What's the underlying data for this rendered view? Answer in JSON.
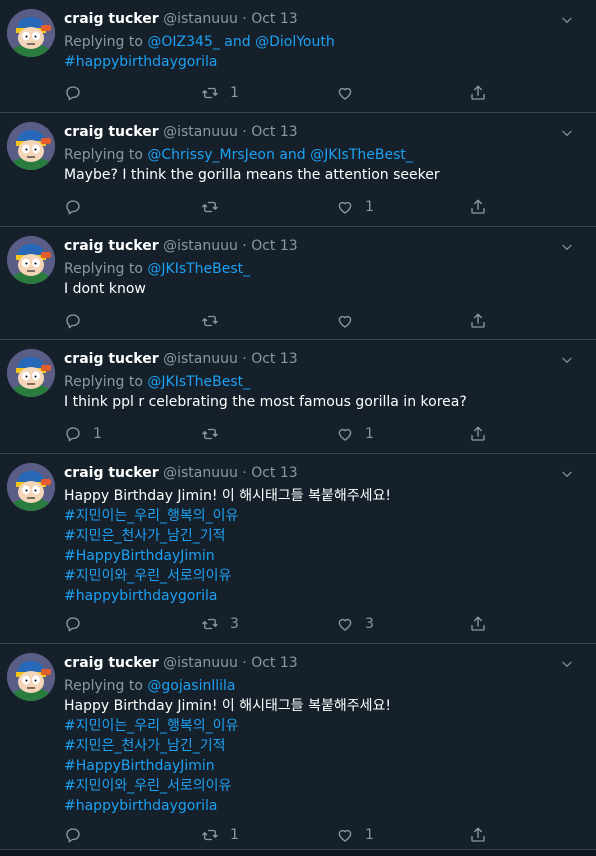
{
  "tweets": [
    {
      "name": "craig tucker",
      "handle": "@istanuuu",
      "sep": "·",
      "time": "Oct 13",
      "reply_prefix": "Replying to",
      "reply_to": "@OIZ345_ and @DiolYouth",
      "text": "",
      "hashtags": [
        "#happybirthdaygorila"
      ],
      "replies": "",
      "retweets": "1",
      "likes": ""
    },
    {
      "name": "craig tucker",
      "handle": "@istanuuu",
      "sep": "·",
      "time": "Oct 13",
      "reply_prefix": "Replying to",
      "reply_to": "@Chrissy_MrsJeon and @JKIsTheBest_",
      "text": "Maybe? I think the gorilla means the attention seeker",
      "hashtags": [],
      "replies": "",
      "retweets": "",
      "likes": "1"
    },
    {
      "name": "craig tucker",
      "handle": "@istanuuu",
      "sep": "·",
      "time": "Oct 13",
      "reply_prefix": "Replying to",
      "reply_to": "@JKIsTheBest_",
      "text": "I dont know",
      "hashtags": [],
      "replies": "",
      "retweets": "",
      "likes": ""
    },
    {
      "name": "craig tucker",
      "handle": "@istanuuu",
      "sep": "·",
      "time": "Oct 13",
      "reply_prefix": "Replying to",
      "reply_to": "@JKIsTheBest_",
      "text": "I think ppl r celebrating the most famous gorilla in korea?",
      "hashtags": [],
      "replies": "1",
      "retweets": "",
      "likes": "1"
    },
    {
      "name": "craig tucker",
      "handle": "@istanuuu",
      "sep": "·",
      "time": "Oct 13",
      "reply_prefix": "",
      "reply_to": "",
      "text": "Happy Birthday Jimin! 이 해시태그들 복붙해주세요!",
      "hashtags": [
        "#지민이는_우리_행복의_이유",
        "#지민은_천사가_남긴_기적",
        "#HappyBirthdayJimin",
        "#지민이와_우린_서로의이유",
        "#happybirthdaygorila"
      ],
      "replies": "",
      "retweets": "3",
      "likes": "3"
    },
    {
      "name": "craig tucker",
      "handle": "@istanuuu",
      "sep": "·",
      "time": "Oct 13",
      "reply_prefix": "Replying to",
      "reply_to": "@gojasinllila",
      "text": "Happy Birthday Jimin! 이 해시태그들 복붙해주세요!",
      "hashtags": [
        "#지민이는_우리_행복의_이유",
        "#지민은_천사가_남긴_기적",
        "#HappyBirthdayJimin",
        "#지민이와_우린_서로의이유",
        "#happybirthdaygorila"
      ],
      "replies": "",
      "retweets": "1",
      "likes": "1"
    }
  ],
  "icons": {
    "reply": "reply-icon",
    "retweet": "retweet-icon",
    "like": "heart-icon",
    "share": "share-icon",
    "more": "chevron-down-icon",
    "avatar": "avatar"
  },
  "colors": {
    "background": "#15202b",
    "link": "#1da1f2",
    "muted": "#8899a6",
    "border": "#38444d"
  }
}
